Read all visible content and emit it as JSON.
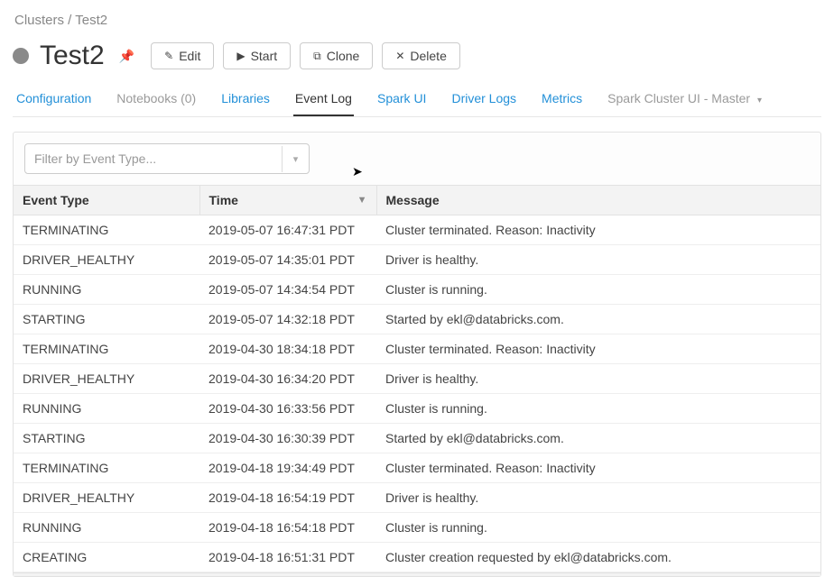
{
  "breadcrumb": {
    "root": "Clusters",
    "sep": " / ",
    "current": "Test2"
  },
  "cluster": {
    "name": "Test2"
  },
  "buttons": {
    "edit": "Edit",
    "start": "Start",
    "clone": "Clone",
    "delete": "Delete"
  },
  "tabs": {
    "configuration": "Configuration",
    "notebooks": "Notebooks (0)",
    "libraries": "Libraries",
    "eventlog": "Event Log",
    "sparkui": "Spark UI",
    "driverlogs": "Driver Logs",
    "metrics": "Metrics",
    "sparkcluster": "Spark Cluster UI - Master"
  },
  "filter": {
    "placeholder": "Filter by Event Type..."
  },
  "columns": {
    "type": "Event Type",
    "time": "Time",
    "message": "Message"
  },
  "events": [
    {
      "type": "TERMINATING",
      "time": "2019-05-07 16:47:31 PDT",
      "message": "Cluster terminated. Reason: Inactivity"
    },
    {
      "type": "DRIVER_HEALTHY",
      "time": "2019-05-07 14:35:01 PDT",
      "message": "Driver is healthy."
    },
    {
      "type": "RUNNING",
      "time": "2019-05-07 14:34:54 PDT",
      "message": "Cluster is running."
    },
    {
      "type": "STARTING",
      "time": "2019-05-07 14:32:18 PDT",
      "message": "Started by ekl@databricks.com."
    },
    {
      "type": "TERMINATING",
      "time": "2019-04-30 18:34:18 PDT",
      "message": "Cluster terminated. Reason: Inactivity"
    },
    {
      "type": "DRIVER_HEALTHY",
      "time": "2019-04-30 16:34:20 PDT",
      "message": "Driver is healthy."
    },
    {
      "type": "RUNNING",
      "time": "2019-04-30 16:33:56 PDT",
      "message": "Cluster is running."
    },
    {
      "type": "STARTING",
      "time": "2019-04-30 16:30:39 PDT",
      "message": "Started by ekl@databricks.com."
    },
    {
      "type": "TERMINATING",
      "time": "2019-04-18 19:34:49 PDT",
      "message": "Cluster terminated. Reason: Inactivity"
    },
    {
      "type": "DRIVER_HEALTHY",
      "time": "2019-04-18 16:54:19 PDT",
      "message": "Driver is healthy."
    },
    {
      "type": "RUNNING",
      "time": "2019-04-18 16:54:18 PDT",
      "message": "Cluster is running."
    },
    {
      "type": "CREATING",
      "time": "2019-04-18 16:51:31 PDT",
      "message": "Cluster creation requested by ekl@databricks.com."
    }
  ]
}
